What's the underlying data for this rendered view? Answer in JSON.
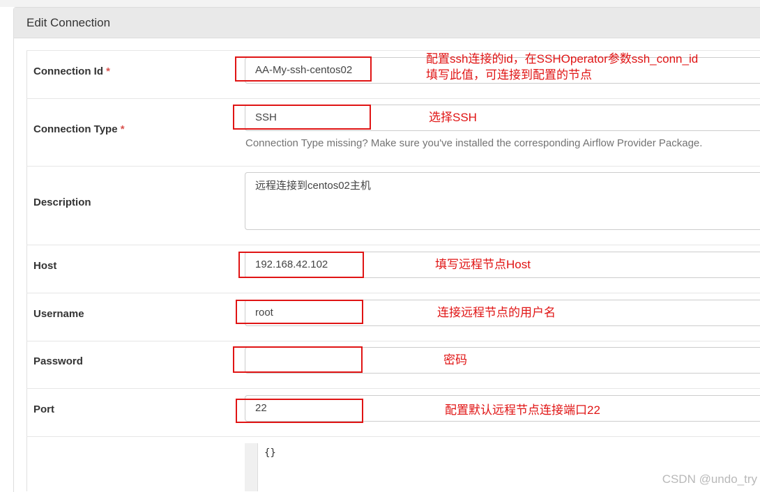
{
  "panel": {
    "title": "Edit Connection"
  },
  "fields": {
    "connection_id": {
      "label": "Connection Id",
      "required": "*",
      "value": "AA-My-ssh-centos02"
    },
    "connection_type": {
      "label": "Connection Type",
      "required": "*",
      "value": "SSH",
      "help": "Connection Type missing? Make sure you've installed the corresponding Airflow Provider Package."
    },
    "description": {
      "label": "Description",
      "value": "远程连接到centos02主机"
    },
    "host": {
      "label": "Host",
      "value": "192.168.42.102"
    },
    "username": {
      "label": "Username",
      "value": "root"
    },
    "password": {
      "label": "Password",
      "value": ""
    },
    "port": {
      "label": "Port",
      "value": "22"
    },
    "extra": {
      "value": "{}"
    }
  },
  "annotations": {
    "connection_id_line1": "配置ssh连接的id，在SSHOperator参数ssh_conn_id",
    "connection_id_line2": "填写此值，可连接到配置的节点",
    "connection_type": "选择SSH",
    "host": "填写远程节点Host",
    "username": "连接远程节点的用户名",
    "password": "密码",
    "port": "配置默认远程节点连接端口22"
  },
  "watermark": "CSDN @undo_try",
  "colors": {
    "annotation_red": "#e01414",
    "required_red": "#d9534f",
    "heading_bg": "#e9e9e9"
  }
}
